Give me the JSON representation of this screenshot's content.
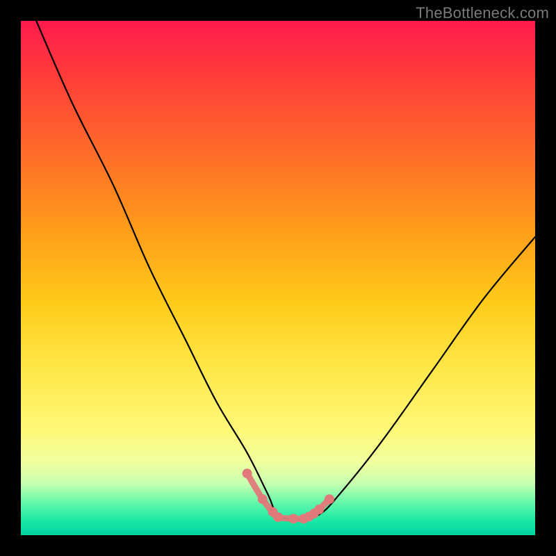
{
  "watermark": "TheBottleneck.com",
  "chart_data": {
    "type": "line",
    "title": "",
    "xlabel": "",
    "ylabel": "",
    "xlim": [
      0,
      100
    ],
    "ylim": [
      0,
      100
    ],
    "series": [
      {
        "name": "curve",
        "x": [
          3,
          10,
          18,
          25,
          32,
          38,
          44,
          48,
          50,
          54,
          58,
          62,
          70,
          80,
          90,
          100
        ],
        "values": [
          100,
          84,
          68,
          52,
          38,
          26,
          16,
          8,
          4,
          3,
          4,
          8,
          18,
          32,
          46,
          58
        ]
      },
      {
        "name": "highlight-points",
        "x": [
          44,
          47,
          49,
          50,
          53,
          55,
          56,
          57,
          58,
          60
        ],
        "values": [
          12,
          7,
          4.5,
          3.5,
          3.2,
          3.2,
          3.6,
          4.2,
          5,
          7
        ]
      }
    ],
    "highlight_color": "#e07a7a",
    "curve_color": "#000000"
  }
}
